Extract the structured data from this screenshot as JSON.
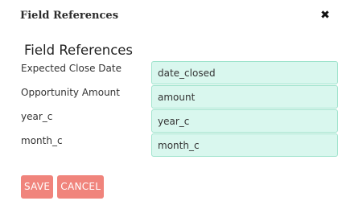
{
  "dialog": {
    "title": "Field References",
    "close_icon": "close-icon"
  },
  "section": {
    "title": "Field References"
  },
  "fields": [
    {
      "label": "Expected Close Date",
      "value": "date_closed"
    },
    {
      "label": "Opportunity Amount",
      "value": "amount"
    },
    {
      "label": "year_c",
      "value": "year_c"
    },
    {
      "label": "month_c",
      "value": "month_c"
    }
  ],
  "buttons": {
    "save_label": "SAVE",
    "cancel_label": "CANCEL"
  },
  "colors": {
    "input_bg": "#d9f7ee",
    "input_border": "#9ee3cc",
    "button_bg": "#f0847c"
  }
}
